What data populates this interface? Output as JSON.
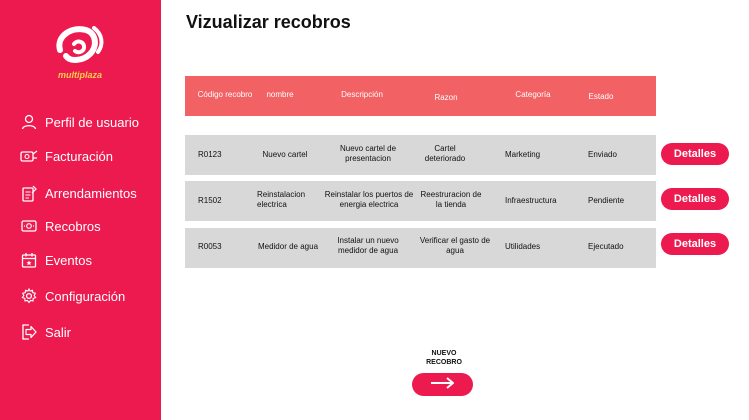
{
  "app": {
    "logo_text": "multiplaza",
    "brand_color": "#ec1a4f",
    "header_color": "#f26163",
    "row_color": "#d8d8d8"
  },
  "sidebar": {
    "items": [
      {
        "label": "Perfil de usuario",
        "icon": "user-icon"
      },
      {
        "label": "Facturación",
        "icon": "billing-icon"
      },
      {
        "label": "Arrendamientos",
        "icon": "lease-icon"
      },
      {
        "label": "Recobros",
        "icon": "recovery-icon"
      },
      {
        "label": "Eventos",
        "icon": "calendar-icon"
      },
      {
        "label": "Configuración",
        "icon": "gear-icon"
      },
      {
        "label": "Salir",
        "icon": "logout-icon"
      }
    ]
  },
  "main": {
    "title": "Vizualizar recobros",
    "columns": [
      "Código recobro",
      "nombre",
      "Descripción",
      "Razon",
      "Categoría",
      "Estado"
    ],
    "rows": [
      {
        "code": "R0123",
        "name": "Nuevo cartel",
        "description": "Nuevo cartel de presentacion",
        "reason": "Cartel deteriorado",
        "category": "Marketing",
        "status": "Enviado",
        "action": "Detalles"
      },
      {
        "code": "R1502",
        "name": "Reinstalacion electrica",
        "description": "Reinstalar los puertos de energia electrica",
        "reason": "Reestruracion de la tienda",
        "category": "Infraestructura",
        "status": "Pendiente",
        "action": "Detalles"
      },
      {
        "code": "R0053",
        "name": "Medidor de agua",
        "description": "Instalar un nuevo medidor de agua",
        "reason": "Verificar el gasto de agua",
        "category": "Utilidades",
        "status": "Ejecutado",
        "action": "Detalles"
      }
    ],
    "new_button_label": "NUEVO RECOBRO",
    "new_button_icon": "arrow-right-icon"
  }
}
